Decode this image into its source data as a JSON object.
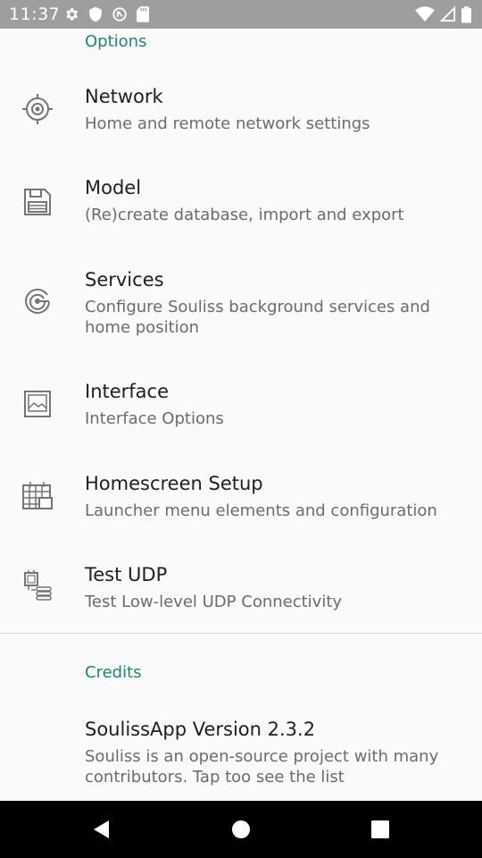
{
  "status_bar": {
    "time": "11:37",
    "left_icons": [
      "gear-icon",
      "shield-icon",
      "no-disturb-icon",
      "sd-card-icon"
    ],
    "right_icons": [
      "wifi-icon",
      "cell-signal-icon",
      "battery-icon"
    ]
  },
  "sections": {
    "options_header": "Options",
    "credits_header": "Credits"
  },
  "items": [
    {
      "title": "Network",
      "summary": "Home and remote network settings",
      "icon": "network-icon"
    },
    {
      "title": "Model",
      "summary": "(Re)create database, import and export",
      "icon": "save-icon"
    },
    {
      "title": "Services",
      "summary": "Configure Souliss background services and home position",
      "icon": "services-icon"
    },
    {
      "title": "Interface",
      "summary": "Interface Options",
      "icon": "image-icon"
    },
    {
      "title": "Homescreen Setup",
      "summary": "Launcher menu elements and configuration",
      "icon": "calendar-grid-icon"
    },
    {
      "title": "Test UDP",
      "summary": "Test Low-level UDP Connectivity",
      "icon": "test-udp-icon"
    }
  ],
  "credits": {
    "title": "SoulissApp Version 2.3.2",
    "summary": "Souliss is an open-source project with many contributors. Tap too see the list"
  },
  "nav_bar": {
    "buttons": [
      "back-icon",
      "home-icon",
      "recents-icon"
    ]
  },
  "colors": {
    "accent": "#1b8a74",
    "status_bar": "#9e9e9e",
    "nav_bar": "#000000",
    "background": "#fafafa"
  }
}
